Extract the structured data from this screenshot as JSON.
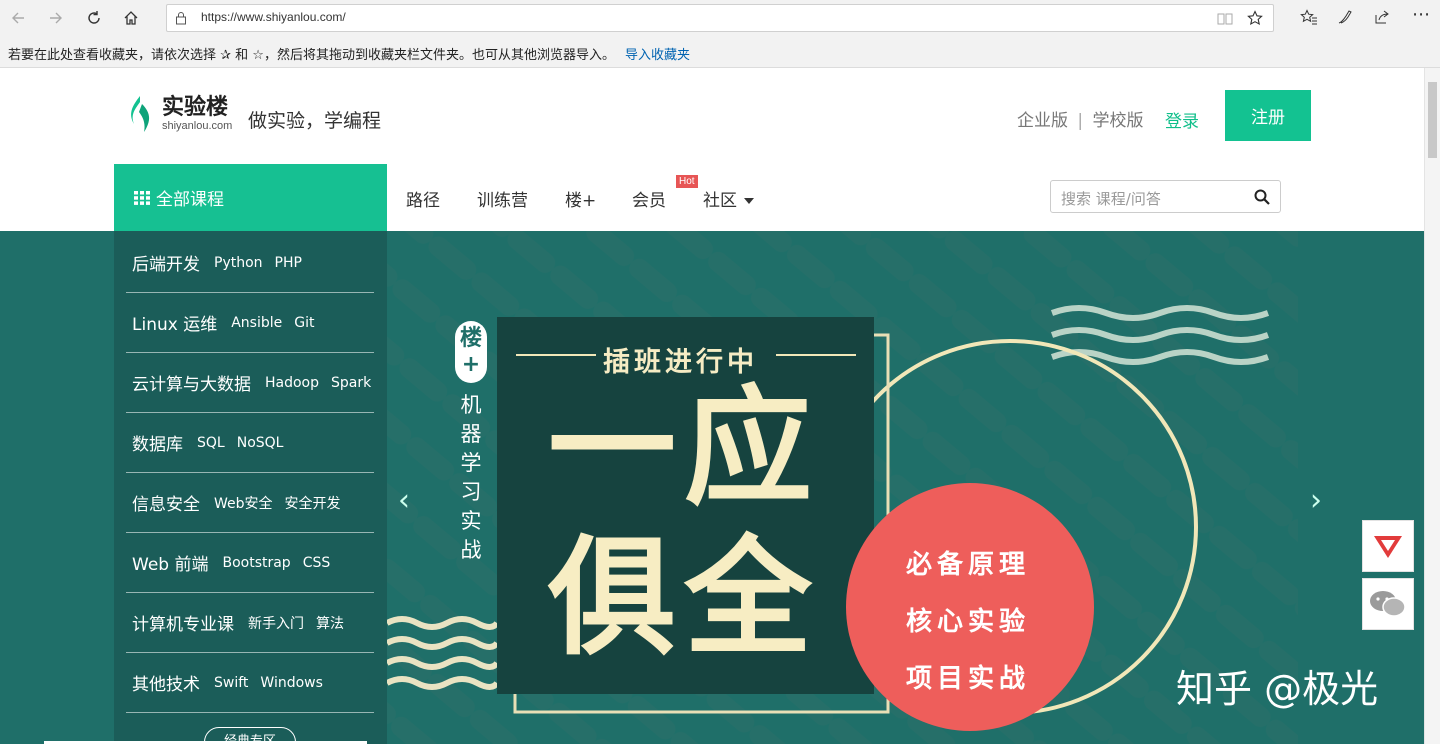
{
  "browser": {
    "url": "https://www.shiyanlou.com/",
    "favorites_hint": "若要在此处查看收藏夹，请依次选择 ✰ 和 ☆，然后将其拖动到收藏夹栏文件夹。也可从其他浏览器导入。",
    "import_link": "导入收藏夹"
  },
  "header": {
    "logo_name": "实验楼",
    "logo_domain": "shiyanlou.com",
    "slogan": "做实验，学编程",
    "enterprise": "企业版",
    "school": "学校版",
    "login": "登录",
    "register": "注册",
    "accent_color": "#13c291"
  },
  "nav": {
    "all_courses": "全部课程",
    "items": [
      "路径",
      "训练营",
      "楼+",
      "会员",
      "社区"
    ],
    "hot_badge": "Hot",
    "search_placeholder": "搜索 课程/问答"
  },
  "sidebar": {
    "categories": [
      {
        "main": "后端开发",
        "subs": [
          "Python",
          "PHP"
        ]
      },
      {
        "main": "Linux 运维",
        "subs": [
          "Ansible",
          "Git"
        ]
      },
      {
        "main": "云计算与大数据",
        "subs": [
          "Hadoop",
          "Spark"
        ]
      },
      {
        "main": "数据库",
        "subs": [
          "SQL",
          "NoSQL"
        ]
      },
      {
        "main": "信息安全",
        "subs": [
          "Web安全",
          "安全开发"
        ]
      },
      {
        "main": "Web 前端",
        "subs": [
          "Bootstrap",
          "CSS"
        ]
      },
      {
        "main": "计算机专业课",
        "subs": [
          "新手入门",
          "算法"
        ]
      },
      {
        "main": "其他技术",
        "subs": [
          "Swift",
          "Windows"
        ]
      }
    ],
    "more_button": "经典专区"
  },
  "banner": {
    "tag_top": "楼",
    "tag_plus": "+",
    "vertical_text": [
      "机",
      "器",
      "学",
      "习",
      "实",
      "战"
    ],
    "headline": "插班进行中",
    "big_line1": "一应",
    "big_line2": "俱全",
    "circle_lines": [
      "必备原理",
      "核心实验",
      "项目实战"
    ],
    "watermark": "知乎 @极光",
    "prev_arrow": "‹",
    "next_arrow": "›"
  }
}
